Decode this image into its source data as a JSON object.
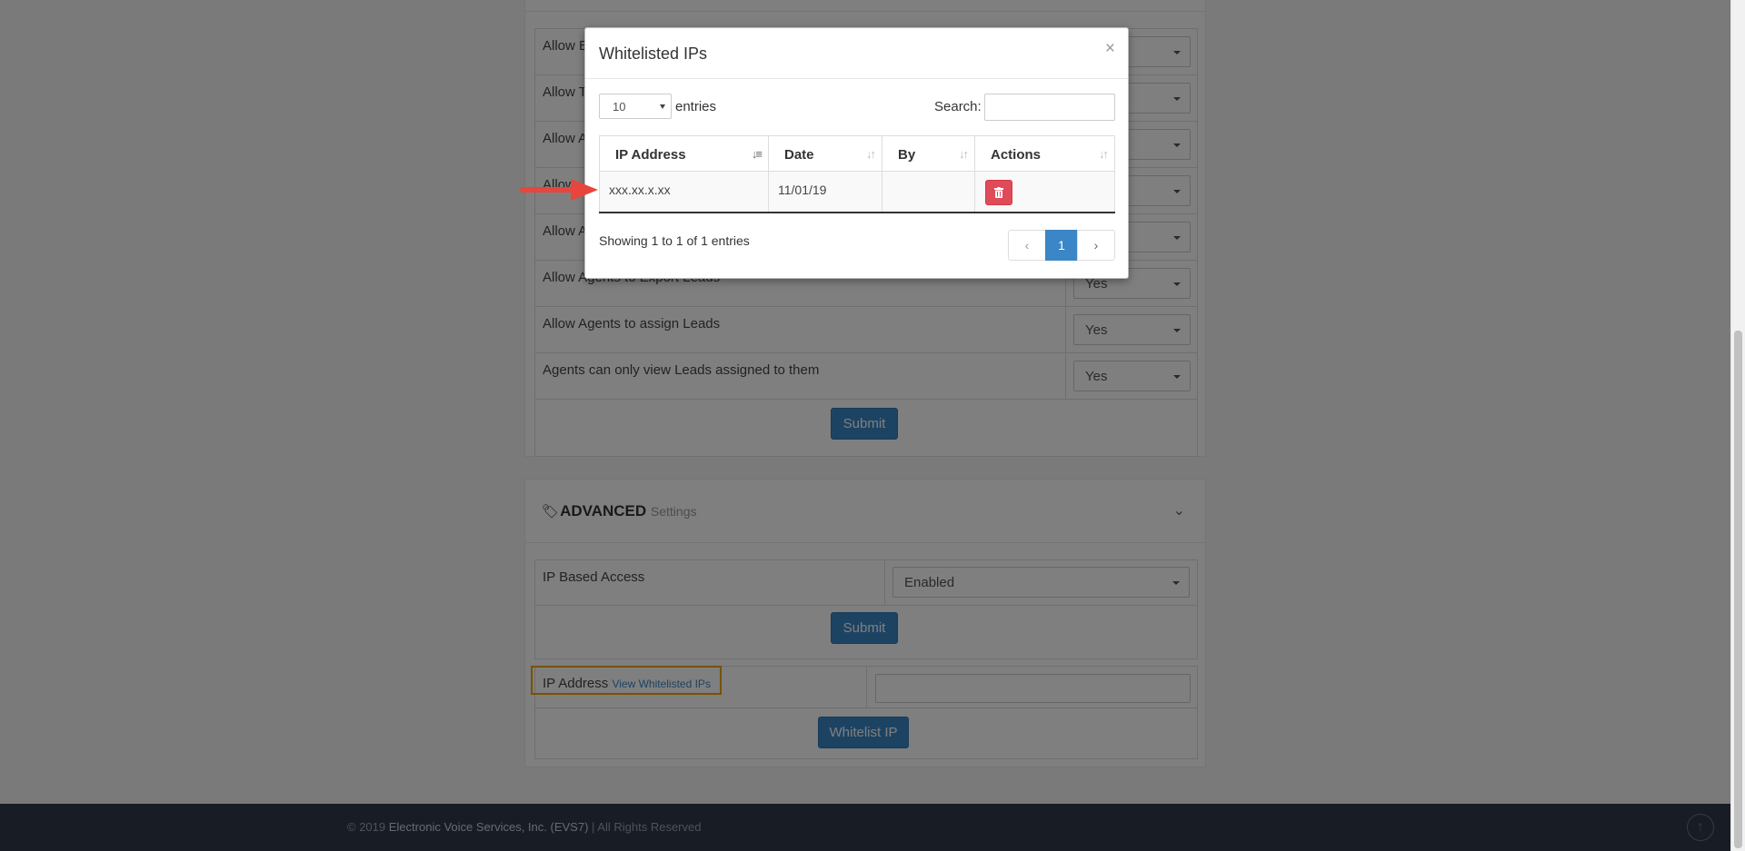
{
  "settings": {
    "rows": [
      {
        "label": "Allow E",
        "value": ""
      },
      {
        "label": "Allow T",
        "value": ""
      },
      {
        "label": "Allow A",
        "value": ""
      },
      {
        "label": "Allow",
        "value": ""
      },
      {
        "label": "Allow A",
        "value": ""
      },
      {
        "label": "Allow Agents to Export Leads",
        "value": "Yes"
      },
      {
        "label": "Allow Agents to assign Leads",
        "value": "Yes"
      },
      {
        "label": "Agents can only view Leads assigned to them",
        "value": "Yes"
      }
    ],
    "submit_label": "Submit"
  },
  "advanced": {
    "title": "ADVANCED",
    "subtitle": "Settings",
    "ip_access_label": "IP Based Access",
    "ip_access_value": "Enabled",
    "submit_label": "Submit",
    "ip_address_label": "IP Address",
    "view_whitelisted_link": "View Whitelisted IPs",
    "whitelist_button": "Whitelist IP"
  },
  "footer": {
    "prefix": "© 2019",
    "brand": "Electronic Voice Services, Inc. (EVS7)",
    "suffix": "| All Rights Reserved"
  },
  "modal": {
    "title": "Whitelisted IPs",
    "close_symbol": "×",
    "page_length": "10",
    "entries_label": "entries",
    "search_label": "Search:",
    "search_value": "",
    "columns": [
      "IP Address",
      "Date",
      "By",
      "Actions"
    ],
    "rows": [
      {
        "ip": "xxx.xx.x.xx",
        "date": "11/01/19",
        "by": ""
      }
    ],
    "info": "Showing 1 to 1 of 1 entries",
    "pager": {
      "prev": "‹",
      "current": "1",
      "next": "›"
    }
  },
  "colors": {
    "primary": "#3b86c6",
    "danger": "#e04b59",
    "highlight": "#f0a500",
    "arrow": "#e8453c",
    "footer_bg": "#303a4a"
  }
}
